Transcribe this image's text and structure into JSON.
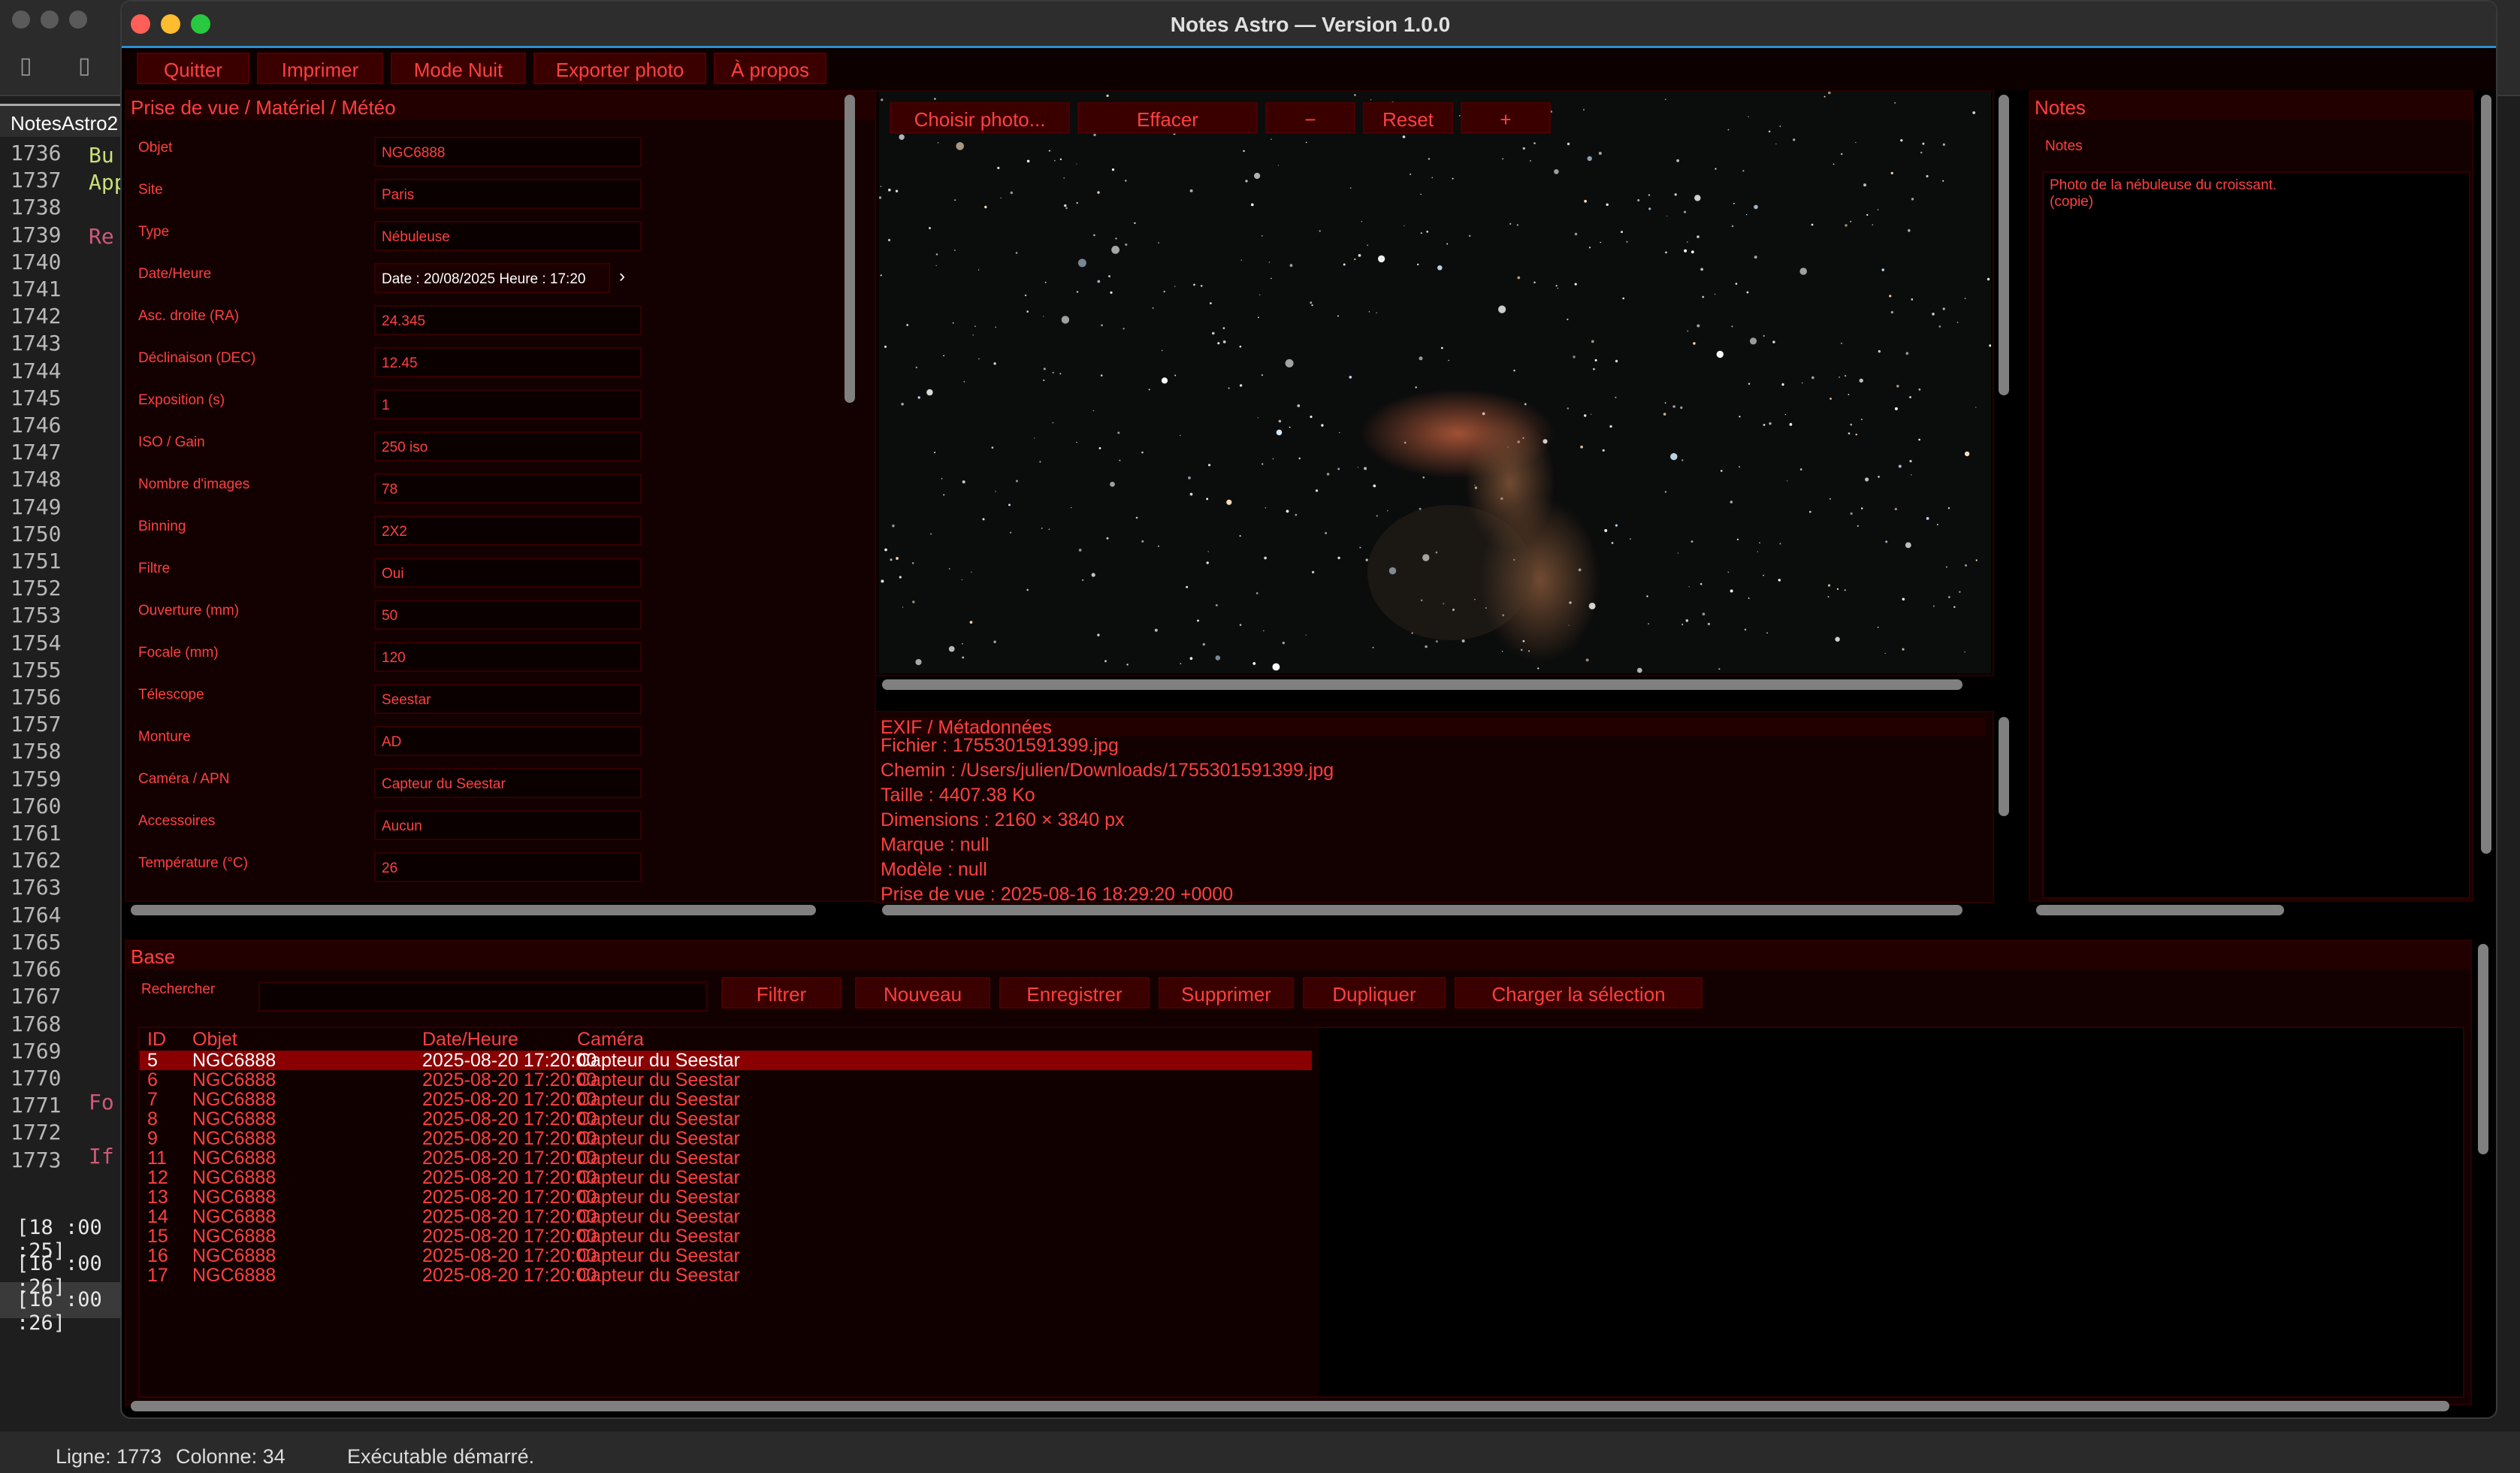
{
  "ide": {
    "tab_label": "NotesAstro2",
    "gutter_lines": [
      "1736",
      "1737",
      "1738",
      "1739",
      "1740",
      "1741",
      "1742",
      "1743",
      "1744",
      "1745",
      "1746",
      "1747",
      "1748",
      "1749",
      "1750",
      "1751",
      "1752",
      "1753",
      "1754",
      "1755",
      "1756",
      "1757",
      "1758",
      "1759",
      "1760",
      "1761",
      "1762",
      "1763",
      "1764",
      "1765",
      "1766",
      "1767",
      "1768",
      "1769",
      "1770",
      "1771",
      "1772",
      "1773"
    ],
    "code_fragments": {
      "a": "Bu",
      "b": "App",
      "c": "Re",
      "d": "Fo",
      "e": "If"
    },
    "log_lines": [
      "[18 :00 :25]",
      "[16 :00 :26]",
      "[16 :00 :26]"
    ],
    "status": {
      "line": "Ligne: 1773",
      "column": "Colonne: 34",
      "message": "Exécutable démarré."
    }
  },
  "window": {
    "title": "Notes Astro — Version 1.0.0",
    "menu": [
      "Quitter",
      "Imprimer",
      "Mode Nuit",
      "Exporter photo",
      "À propos"
    ]
  },
  "form": {
    "heading": "Prise de vue / Matériel / Météo",
    "fields": [
      {
        "label": "Objet",
        "value": "NGC6888"
      },
      {
        "label": "Site",
        "value": "Paris"
      },
      {
        "label": "Type",
        "value": "Nébuleuse"
      },
      {
        "label": "Date/Heure",
        "value": "Date : 20/08/2025 Heure : 17:20"
      },
      {
        "label": "Asc. droite (RA)",
        "value": "24.345"
      },
      {
        "label": "Déclinaison (DEC)",
        "value": "12.45"
      },
      {
        "label": "Exposition (s)",
        "value": "1"
      },
      {
        "label": "ISO / Gain",
        "value": "250 iso"
      },
      {
        "label": "Nombre d'images",
        "value": "78"
      },
      {
        "label": "Binning",
        "value": "2X2"
      },
      {
        "label": "Filtre",
        "value": "Oui"
      },
      {
        "label": "Ouverture (mm)",
        "value": "50"
      },
      {
        "label": "Focale (mm)",
        "value": "120"
      },
      {
        "label": "Télescope",
        "value": "Seestar"
      },
      {
        "label": "Monture",
        "value": "AD"
      },
      {
        "label": "Caméra / APN",
        "value": "Capteur du Seestar"
      },
      {
        "label": "Accessoires",
        "value": "Aucun"
      },
      {
        "label": "Température (°C)",
        "value": "26"
      }
    ]
  },
  "photo": {
    "buttons": [
      "Choisir photo...",
      "Effacer",
      "−",
      "Reset",
      "+"
    ]
  },
  "exif": {
    "heading": "EXIF / Métadonnées",
    "lines": [
      "Fichier : 1755301591399.jpg",
      "Chemin : /Users/julien/Downloads/1755301591399.jpg",
      "Taille : 4407.38 Ko",
      "Dimensions : 2160 × 3840 px",
      "Marque : null",
      "Modèle : null",
      "Prise de vue : 2025-08-16 18:29:20 +0000"
    ]
  },
  "notes": {
    "heading": "Notes",
    "label": "Notes",
    "text_line1": "Photo de la nébuleuse du croissant.",
    "text_line2": "(copie)"
  },
  "base": {
    "heading": "Base",
    "search_label": "Rechercher",
    "search_value": "",
    "buttons": [
      "Filtrer",
      "Nouveau",
      "Enregistrer",
      "Supprimer",
      "Dupliquer",
      "Charger la sélection"
    ],
    "columns": [
      "ID",
      "Objet",
      "Date/Heure",
      "Caméra"
    ],
    "rows": [
      [
        "5",
        "NGC6888",
        "2025-08-20 17:20:00",
        "Capteur du Seestar"
      ],
      [
        "6",
        "NGC6888",
        "2025-08-20 17:20:00",
        "Capteur du Seestar"
      ],
      [
        "7",
        "NGC6888",
        "2025-08-20 17:20:00",
        "Capteur du Seestar"
      ],
      [
        "8",
        "NGC6888",
        "2025-08-20 17:20:00",
        "Capteur du Seestar"
      ],
      [
        "9",
        "NGC6888",
        "2025-08-20 17:20:00",
        "Capteur du Seestar"
      ],
      [
        "11",
        "NGC6888",
        "2025-08-20 17:20:00",
        "Capteur du Seestar"
      ],
      [
        "12",
        "NGC6888",
        "2025-08-20 17:20:00",
        "Capteur du Seestar"
      ],
      [
        "13",
        "NGC6888",
        "2025-08-20 17:20:00",
        "Capteur du Seestar"
      ],
      [
        "14",
        "NGC6888",
        "2025-08-20 17:20:00",
        "Capteur du Seestar"
      ],
      [
        "15",
        "NGC6888",
        "2025-08-20 17:20:00",
        "Capteur du Seestar"
      ],
      [
        "16",
        "NGC6888",
        "2025-08-20 17:20:00",
        "Capteur du Seestar"
      ],
      [
        "17",
        "NGC6888",
        "2025-08-20 17:20:00",
        "Capteur du Seestar"
      ]
    ]
  },
  "colors": {
    "accent": "#ff4040",
    "panel_bg": "#130000",
    "button_bg": "#3a0000",
    "selected_row": "#8a0000",
    "title_underline": "#2a8fd0"
  }
}
